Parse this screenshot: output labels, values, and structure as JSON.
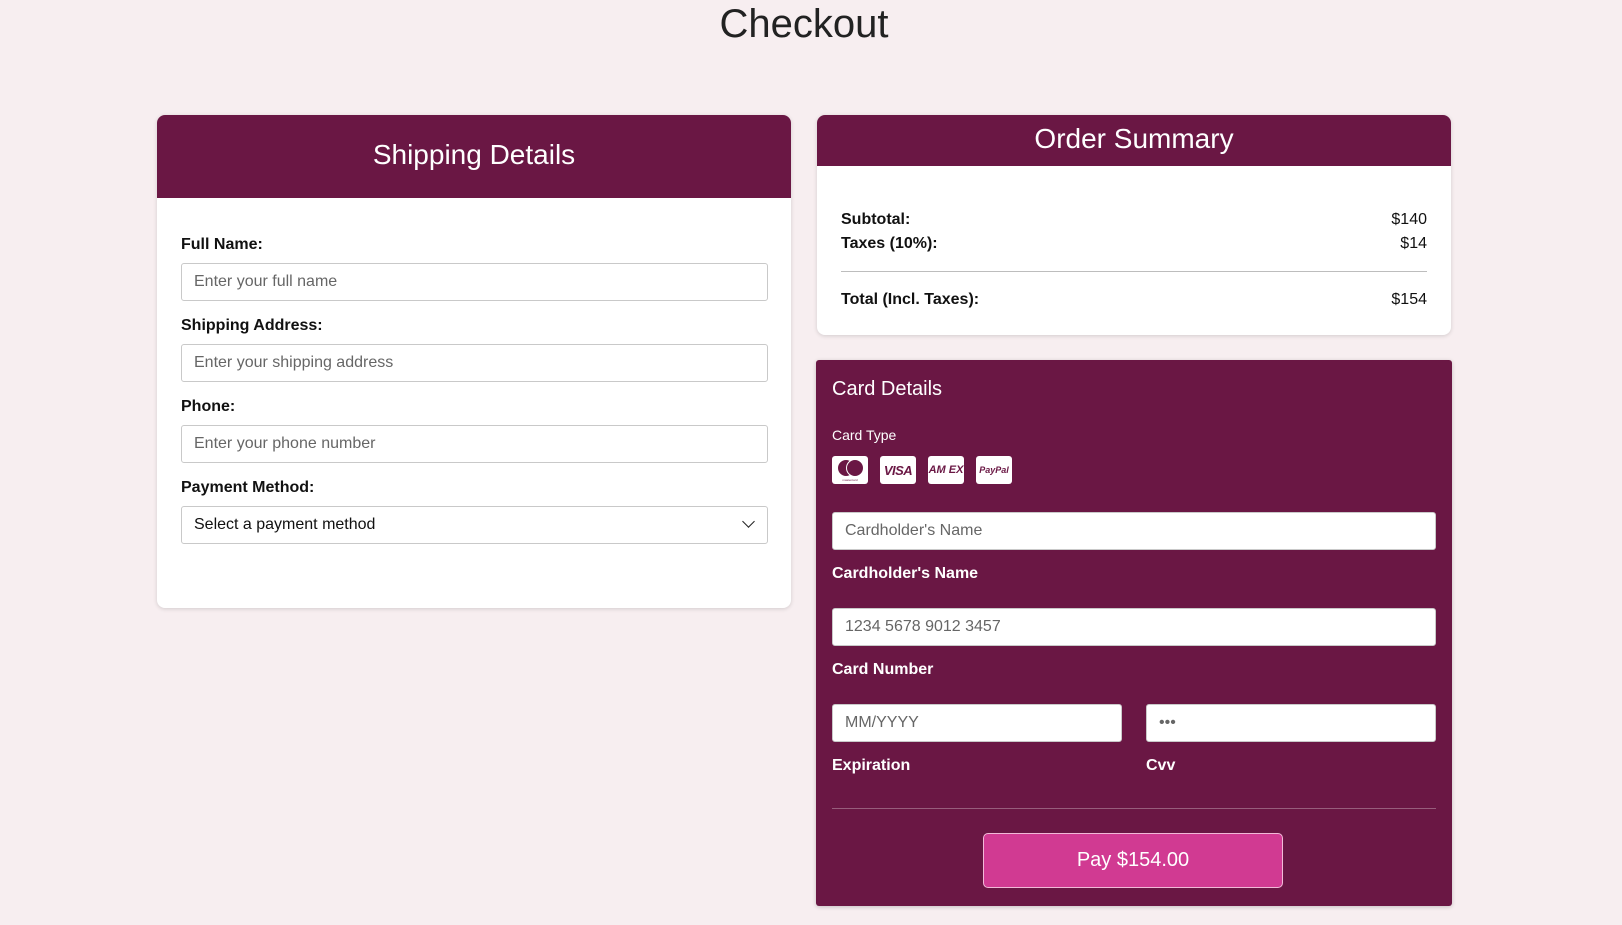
{
  "page": {
    "title": "Checkout"
  },
  "shipping": {
    "header": "Shipping Details",
    "fields": [
      {
        "label": "Full Name:",
        "placeholder": "Enter your full name",
        "value": ""
      },
      {
        "label": "Shipping Address:",
        "placeholder": "Enter your shipping address",
        "value": ""
      },
      {
        "label": "Phone:",
        "placeholder": "Enter your phone number",
        "value": ""
      }
    ],
    "payment_method": {
      "label": "Payment Method:",
      "selected": "Select a payment method"
    }
  },
  "summary": {
    "header": "Order Summary",
    "rows": [
      {
        "label": "Subtotal:",
        "value": "$140"
      },
      {
        "label": "Taxes (10%):",
        "value": "$14"
      }
    ],
    "total": {
      "label": "Total (Incl. Taxes):",
      "value": "$154"
    }
  },
  "card": {
    "title": "Card Details",
    "card_type_label": "Card Type",
    "card_types": [
      {
        "name": "mastercard-icon",
        "text": "mastercard"
      },
      {
        "name": "visa-icon",
        "text": "VISA"
      },
      {
        "name": "amex-icon",
        "text": "AM EX"
      },
      {
        "name": "paypal-icon",
        "text": "PayPal"
      }
    ],
    "holder": {
      "placeholder": "Cardholder's Name",
      "label": "Cardholder's Name"
    },
    "number": {
      "placeholder": "1234 5678 9012 3457",
      "label": "Card Number"
    },
    "expiration": {
      "placeholder": "MM/YYYY",
      "label": "Expiration"
    },
    "cvv": {
      "placeholder": "•••",
      "label": "Cvv"
    },
    "pay_button": "Pay $154.00"
  },
  "colors": {
    "background": "#f7eef0",
    "primary": "#6a1744",
    "accent": "#d13a92"
  }
}
